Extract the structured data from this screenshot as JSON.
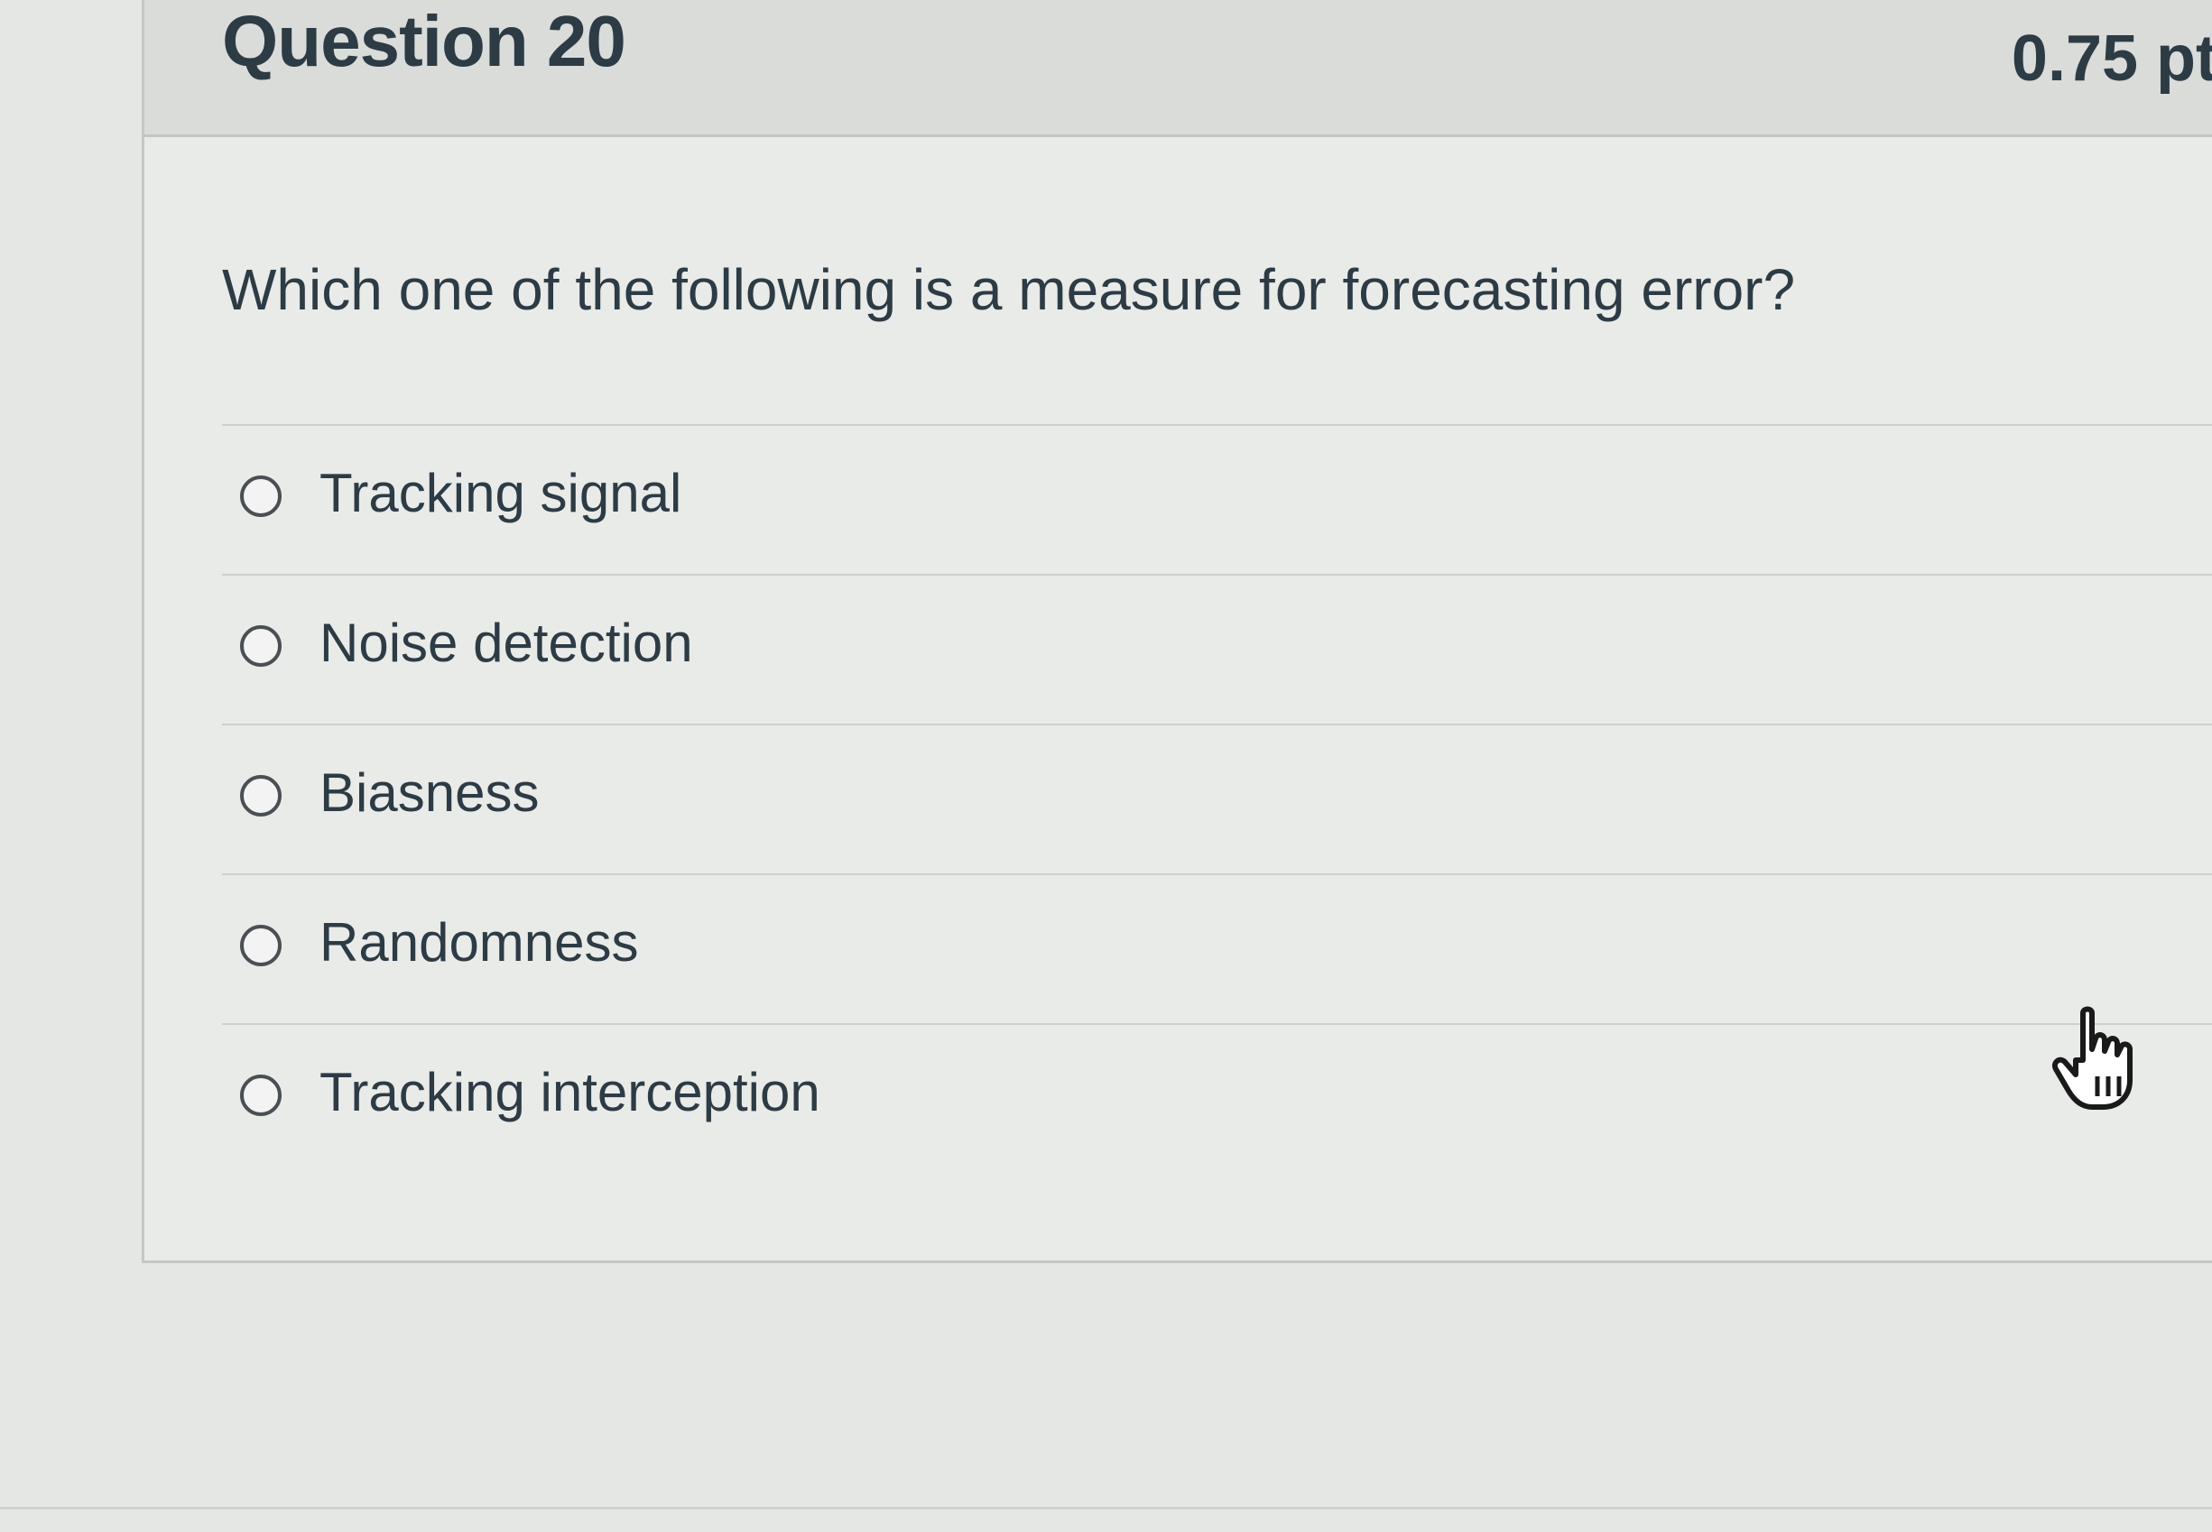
{
  "question": {
    "title": "Question 20",
    "points": "0.75 pt",
    "text": "Which one of the following is a measure for forecasting error?"
  },
  "answers": [
    {
      "label": "Tracking signal"
    },
    {
      "label": "Noise detection"
    },
    {
      "label": "Biasness"
    },
    {
      "label": "Randomness"
    },
    {
      "label": "Tracking interception"
    }
  ],
  "cursor": {
    "icon": "pointer-hand-icon"
  }
}
